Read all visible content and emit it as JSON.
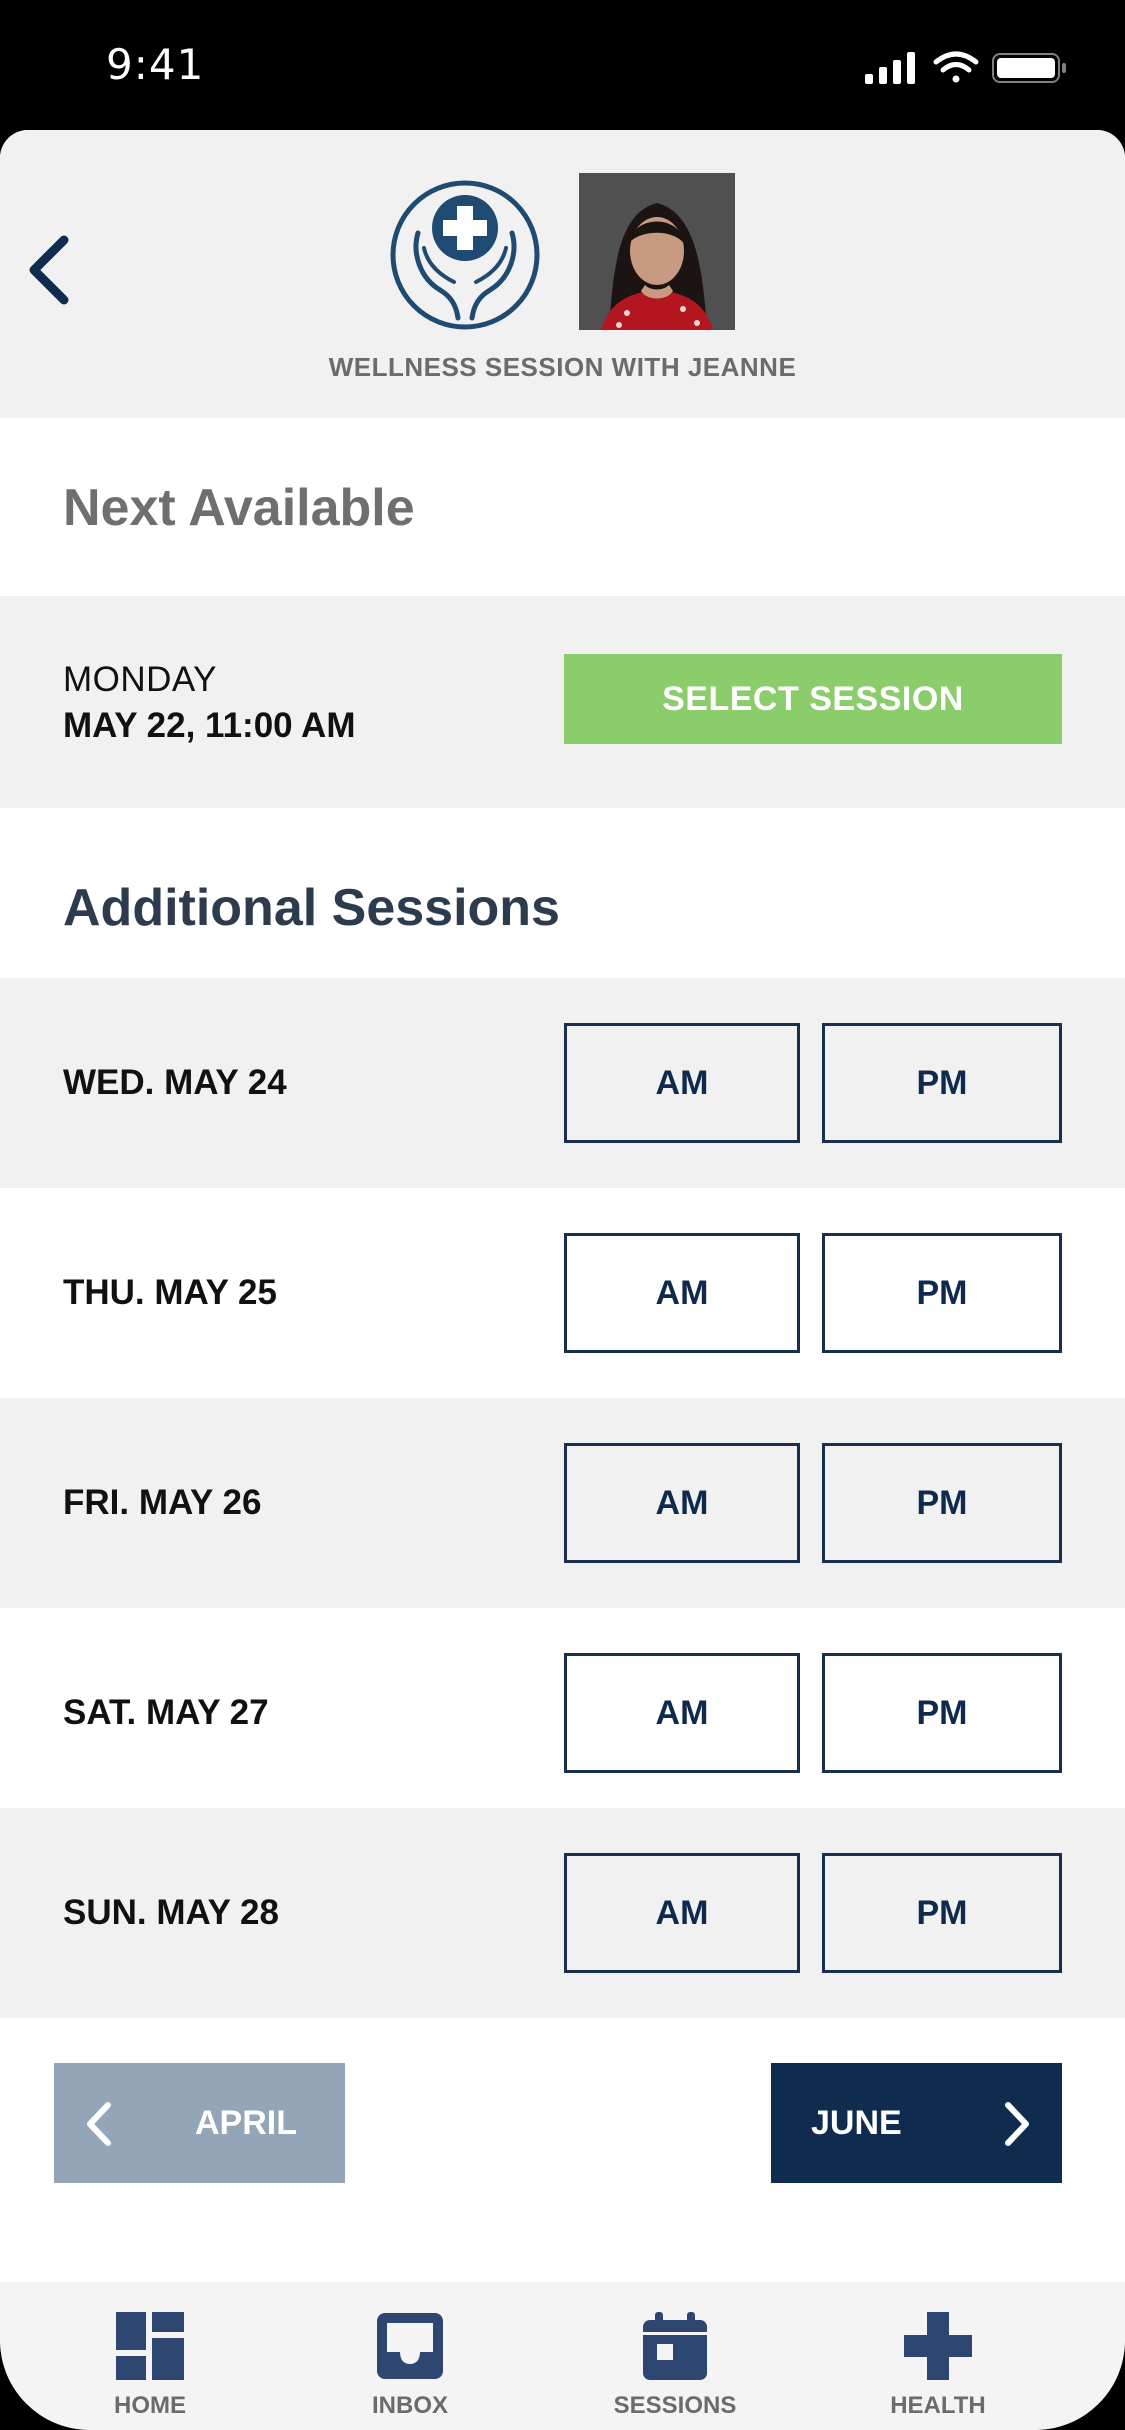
{
  "status_bar": {
    "time": "9:41"
  },
  "header": {
    "back_icon": "chevron-left-icon",
    "logo_icon": "hands-medical-cross-icon",
    "title": "WELLNESS SESSION WITH JEANNE",
    "colors": {
      "logo": "#1f4a72",
      "back": "#0f2b4d"
    }
  },
  "next_available": {
    "title": "Next Available",
    "day": "MONDAY",
    "date": "MAY 22, 11:00 AM",
    "select_label": "SELECT SESSION",
    "select_color": "#8bcc6b"
  },
  "additional": {
    "title": "Additional Sessions",
    "days": [
      {
        "label": "WED. MAY 24",
        "am": "AM",
        "pm": "PM"
      },
      {
        "label": "THU. MAY 25",
        "am": "AM",
        "pm": "PM"
      },
      {
        "label": "FRI. MAY 26",
        "am": "AM",
        "pm": "PM"
      },
      {
        "label": "SAT. MAY 27",
        "am": "AM",
        "pm": "PM"
      },
      {
        "label": "SUN. MAY 28",
        "am": "AM",
        "pm": "PM"
      }
    ]
  },
  "month_nav": {
    "prev_label": "APRIL",
    "next_label": "JUNE",
    "prev_color": "#93a5b6",
    "next_color": "#0f2b4d"
  },
  "tab_bar": {
    "items": [
      {
        "label": "HOME",
        "icon": "dashboard-icon"
      },
      {
        "label": "INBOX",
        "icon": "inbox-icon"
      },
      {
        "label": "SESSIONS",
        "icon": "calendar-icon"
      },
      {
        "label": "HEALTH",
        "icon": "medical-cross-icon"
      }
    ],
    "icon_color": "#2d4672"
  }
}
